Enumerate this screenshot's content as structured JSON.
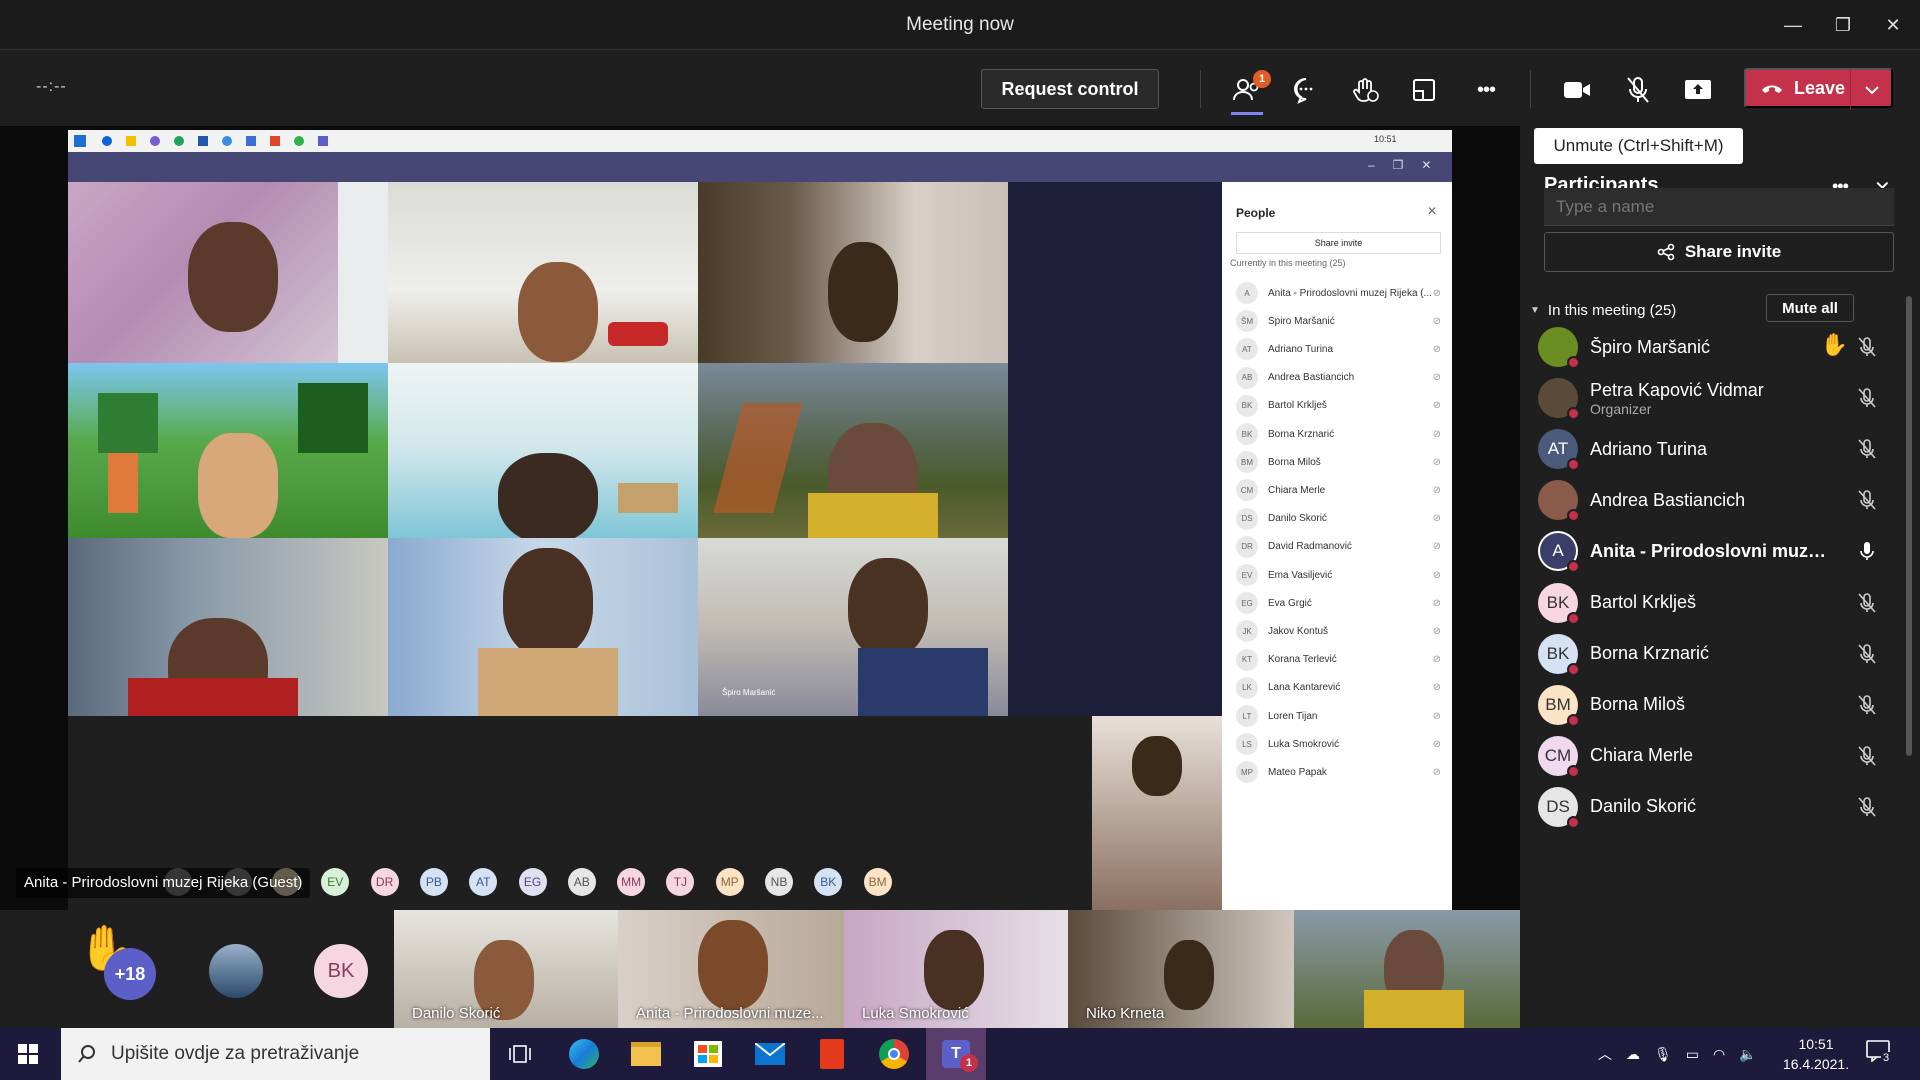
{
  "window": {
    "title": "Meeting now",
    "minimize": "—",
    "maximize": "❐",
    "close": "✕"
  },
  "toolbar": {
    "timer": "--:--",
    "request_control": "Request control",
    "participants_badge": "1",
    "more": "•••",
    "leave": "Leave",
    "icons": [
      "people-icon",
      "chat-icon",
      "reactions-icon",
      "rooms-icon",
      "more-icon",
      "camera-icon",
      "mic-muted-icon",
      "share-icon"
    ]
  },
  "tooltip": "Unmute (Ctrl+Shift+M)",
  "shared_screen": {
    "tray_time": "10:51",
    "people_panel": {
      "title": "People",
      "share_invite": "Share invite",
      "section": "Currently in this meeting (25)",
      "rows": [
        {
          "initials": "A",
          "name": "Anita - Prirodoslovni muzej Rijeka (..."
        },
        {
          "initials": "ŠM",
          "name": "Špiro Maršanić"
        },
        {
          "initials": "AT",
          "name": "Adriano Turina"
        },
        {
          "initials": "AB",
          "name": "Andrea Bastiancich"
        },
        {
          "initials": "BK",
          "name": "Bartol Krklješ"
        },
        {
          "initials": "BK",
          "name": "Borna Krznarić"
        },
        {
          "initials": "BM",
          "name": "Borna Miloš"
        },
        {
          "initials": "CM",
          "name": "Chiara Merle"
        },
        {
          "initials": "DS",
          "name": "Danilo Skorić"
        },
        {
          "initials": "DR",
          "name": "David Radmanović"
        },
        {
          "initials": "EV",
          "name": "Ema Vasiljević"
        },
        {
          "initials": "EG",
          "name": "Eva Grgić"
        },
        {
          "initials": "JK",
          "name": "Jakov Kontuš"
        },
        {
          "initials": "KT",
          "name": "Korana Terlević"
        },
        {
          "initials": "LK",
          "name": "Lana Kantarević"
        },
        {
          "initials": "LT",
          "name": "Loren Tijan"
        },
        {
          "initials": "LS",
          "name": "Luka Smokrović"
        },
        {
          "initials": "MP",
          "name": "Mateo Papak"
        }
      ]
    },
    "tile_label": "Špiro Maršanić",
    "avatar_row": [
      "LK",
      "EV",
      "DR",
      "PB",
      "AT",
      "EG",
      "AB",
      "MM",
      "TJ",
      "MP",
      "NB",
      "BK",
      "BM"
    ],
    "guest_label": "Anita - Prirodoslovni muzej Rijeka (Guest)"
  },
  "strip": {
    "overflow": "+18",
    "initials": "BK",
    "thumbs": [
      {
        "name": "Danilo Skorić"
      },
      {
        "name": "Anita - Prirodoslovni muze..."
      },
      {
        "name": "Luka Smokrović"
      },
      {
        "name": "Niko Krneta"
      },
      {
        "name": ""
      }
    ]
  },
  "participants": {
    "title": "Participants",
    "more": "•••",
    "close": "✕",
    "search_placeholder": "Type a name",
    "share_invite": "Share invite",
    "section": "In this meeting (25)",
    "mute_all": "Mute all",
    "list": [
      {
        "initials": "",
        "name": "Špiro Maršanić",
        "sub": "",
        "color": "#6b8e23",
        "hand": true,
        "mic": "muted"
      },
      {
        "initials": "",
        "name": "Petra Kapović Vidmar",
        "sub": "Organizer",
        "color": "#5a4a3a",
        "hand": false,
        "mic": "muted"
      },
      {
        "initials": "AT",
        "name": "Adriano Turina",
        "sub": "",
        "color": "#4a5a7a",
        "hand": false,
        "mic": "muted"
      },
      {
        "initials": "",
        "name": "Andrea Bastiancich",
        "sub": "",
        "color": "#8a5a4a",
        "hand": false,
        "mic": "muted"
      },
      {
        "initials": "A",
        "name": "Anita - Prirodoslovni muzej ...",
        "sub": "",
        "color": "#3b3d6b",
        "hand": false,
        "mic": "on"
      },
      {
        "initials": "BK",
        "name": "Bartol Krklješ",
        "sub": "",
        "color": "#f6d6e0",
        "hand": false,
        "mic": "muted"
      },
      {
        "initials": "BK",
        "name": "Borna Krznarić",
        "sub": "",
        "color": "#d4e2f4",
        "hand": false,
        "mic": "muted"
      },
      {
        "initials": "BM",
        "name": "Borna Miloš",
        "sub": "",
        "color": "#fbe3c6",
        "hand": false,
        "mic": "muted"
      },
      {
        "initials": "CM",
        "name": "Chiara Merle",
        "sub": "",
        "color": "#f0d9ef",
        "hand": false,
        "mic": "muted"
      },
      {
        "initials": "DS",
        "name": "Danilo Skorić",
        "sub": "",
        "color": "#e6e6e6",
        "hand": false,
        "mic": "muted"
      }
    ]
  },
  "taskbar": {
    "search_placeholder": "Upišite ovdje za pretraživanje",
    "teams_badge": "1",
    "time": "10:51",
    "date": "16.4.2021.",
    "notifications": "3"
  },
  "colors": {
    "accent": "#6264a7",
    "leave": "#c4314b",
    "badge": "#e35b27"
  }
}
